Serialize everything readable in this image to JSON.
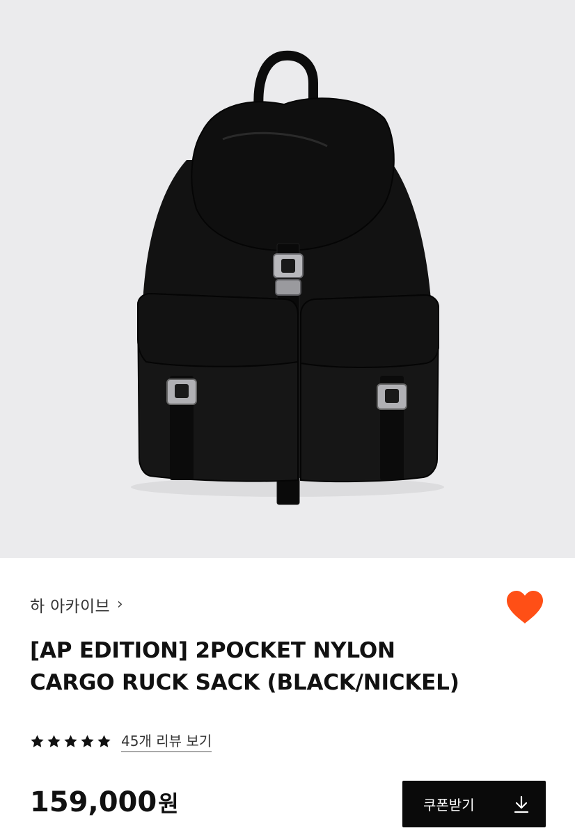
{
  "product_image": {
    "icon": "backpack-image",
    "background": "#ebebed"
  },
  "brand": {
    "name": "하 아카이브",
    "chevron": "›"
  },
  "wishlist": {
    "icon": "heart-icon",
    "color": "#ff4f16"
  },
  "product": {
    "title_line1": "[AP EDITION] 2POCKET NYLON",
    "title_line2": "CARGO RUCK SACK (BLACK/NICKEL)"
  },
  "rating": {
    "stars": 5,
    "review_link": "45개 리뷰 보기"
  },
  "price": {
    "amount": "159,000",
    "currency": "원"
  },
  "coupon": {
    "label": "쿠폰받기",
    "icon": "download-icon"
  }
}
